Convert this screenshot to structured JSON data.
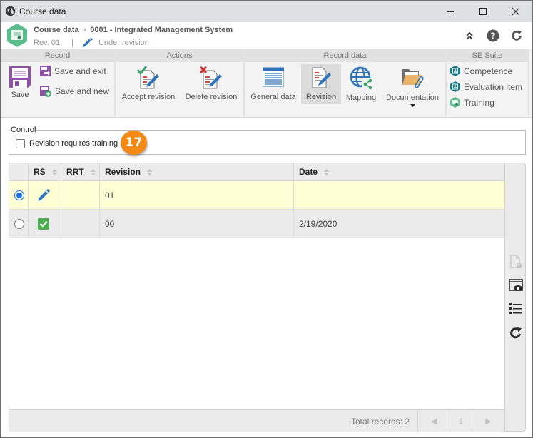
{
  "window": {
    "title": "Course data",
    "controls": {
      "minimize": "minimize",
      "maximize": "maximize",
      "close": "close"
    }
  },
  "header": {
    "breadcrumb_root": "Course data",
    "breadcrumb_separator": "›",
    "breadcrumb_current": "0001 - Integrated Management System",
    "revision_label": "Rev. 01",
    "divider": "|",
    "status": "Under revision",
    "icons": [
      "collapse-icon",
      "help-icon",
      "refresh-icon"
    ]
  },
  "ribbon": {
    "groups": {
      "record": "Record",
      "actions": "Actions",
      "record_data": "Record data",
      "se_suite": "SE Suite"
    },
    "record": {
      "save": "Save",
      "save_and_exit": "Save and exit",
      "save_and_new": "Save and new"
    },
    "actions": {
      "accept_revision": "Accept revision",
      "delete_revision": "Delete revision"
    },
    "record_data": {
      "general_data": "General data",
      "revision": "Revision",
      "mapping": "Mapping",
      "documentation": "Documentation"
    },
    "se_suite": {
      "competence": "Competence",
      "evaluation_item": "Evaluation item",
      "training": "Training"
    }
  },
  "control": {
    "legend": "Control",
    "checkbox_label": "Revision requires training",
    "checked": false,
    "badge": "17"
  },
  "grid": {
    "columns": [
      "RS",
      "RRT",
      "Revision",
      "Date"
    ],
    "rows": [
      {
        "selected": true,
        "rs": "pencil-icon",
        "rrt": "",
        "revision": "01",
        "date": ""
      },
      {
        "selected": false,
        "rs": "check-icon",
        "rrt": "",
        "revision": "00",
        "date": "2/19/2020"
      }
    ],
    "footer": {
      "total": "Total records: 2",
      "page": "1",
      "prev": "◀",
      "next": "▶"
    }
  },
  "colors": {
    "accent_purple": "#8e4fa6",
    "badge_orange": "#f28a15",
    "selected_row": "#ffffd6",
    "teal": "#127a83",
    "green": "#4caf50",
    "blue": "#2e73b8"
  }
}
